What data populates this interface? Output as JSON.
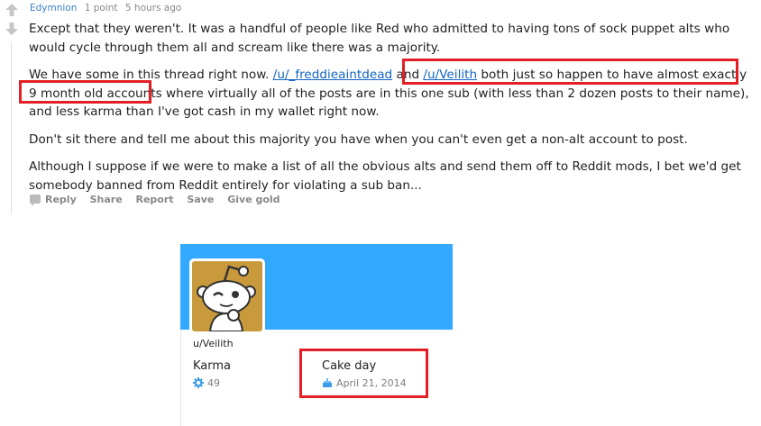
{
  "comment": {
    "author": "Edymnion",
    "score": "1 point",
    "age": "5 hours ago",
    "paragraphs": {
      "p1": "Except that they weren't. It was a handful of people like Red who admitted to having tons of sock puppet alts who would cycle through them all and scream like there was a majority.",
      "p2_start": "We have some in this thread right now. ",
      "p2_link1": "/u/_freddieaintdead",
      "p2_mid": " and ",
      "p2_link2": "/u/Veilith",
      "p2_end": " both just so happen to have almost exactly 9 month old accounts where virtually all of the posts are in this one sub (with less than 2 dozen posts to their name), and less karma than I've got cash in my wallet right now.",
      "p3": "Don't sit there and tell me about this majority you have when you can't even get a non-alt account to post.",
      "p4": "Although I suppose if we were to make a list of all the obvious alts and send them off to Reddit mods, I bet we'd get somebody banned from Reddit entirely for violating a sub ban..."
    },
    "actions": {
      "reply": "Reply",
      "share": "Share",
      "report": "Report",
      "save": "Save",
      "give_gold": "Give gold"
    }
  },
  "profile": {
    "username": "u/Veilith",
    "karma_label": "Karma",
    "karma_value": "49",
    "cakeday_label": "Cake day",
    "cakeday_value": "April 21, 2014"
  },
  "colors": {
    "banner": "#33a8ff",
    "highlight": "#e31e24",
    "link": "#1265c4",
    "author": "#3b80c4",
    "avatar_bg": "#c99a3b"
  },
  "icons": {
    "upvote": "upvote-arrow-icon",
    "downvote": "downvote-arrow-icon",
    "comment": "comment-icon",
    "karma": "karma-icon",
    "cake": "cake-icon",
    "avatar": "snoo-avatar-icon"
  }
}
